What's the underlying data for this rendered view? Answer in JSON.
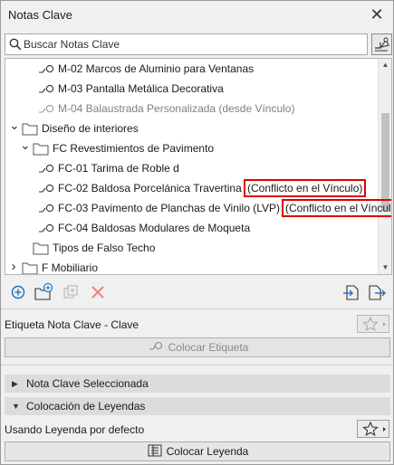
{
  "window": {
    "title": "Notas Clave",
    "close_glyph": "✕"
  },
  "search": {
    "placeholder": "Buscar Notas Clave"
  },
  "tree": {
    "items": [
      {
        "label": "M-02 Marcos de Aluminio para Ventanas",
        "type": "key",
        "level": 3,
        "gray": false
      },
      {
        "label": "M-03 Pantalla Metálica Decorativa",
        "type": "key",
        "level": 3,
        "gray": false
      },
      {
        "label": "M-04 Balaustrada Personalizada (desde Vínculo)",
        "type": "key",
        "level": 3,
        "gray": true
      },
      {
        "label": "Diseño de interiores",
        "type": "folder",
        "level": 1,
        "expanded": true
      },
      {
        "label": "FC Revestimientos de Pavimento",
        "type": "folder",
        "level": 2,
        "expanded": true
      },
      {
        "label": "FC-01 Tarima de Roble d",
        "type": "key",
        "level": 3,
        "gray": false
      },
      {
        "label": "FC-02 Baldosa Porcelánica Travertina",
        "type": "key",
        "level": 3,
        "gray": false,
        "conflict": "(Conflicto en el Vínculo)"
      },
      {
        "label": "FC-03 Pavimento de Planchas de Vinilo (LVP)",
        "type": "key",
        "level": 3,
        "gray": false,
        "conflict": "(Conflicto en el Vínculo)"
      },
      {
        "label": "FC-04 Baldosas Modulares de Moqueta",
        "type": "key",
        "level": 3,
        "gray": false
      },
      {
        "label": "Tipos de Falso Techo",
        "type": "folder",
        "level": 2,
        "expanded": false,
        "no_chevron": true
      },
      {
        "label": "F Mobiliario",
        "type": "folder",
        "level": 1,
        "expanded": false
      }
    ]
  },
  "toolbar": {
    "buttons": [
      "add-key-note",
      "add-folder",
      "duplicate",
      "delete",
      "import",
      "export"
    ]
  },
  "label_section": {
    "title": "Etiqueta Nota Clave - Clave",
    "place_label_button": "Colocar Etiqueta"
  },
  "sections": {
    "selected": "Nota Clave Seleccionada",
    "legends": "Colocación de Leyendas"
  },
  "legend": {
    "using_default": "Usando Leyenda por defecto",
    "place_legend_button": "Colocar Leyenda"
  },
  "colors": {
    "conflict_border": "#e00000",
    "accent_blue": "#1b6ec2"
  }
}
